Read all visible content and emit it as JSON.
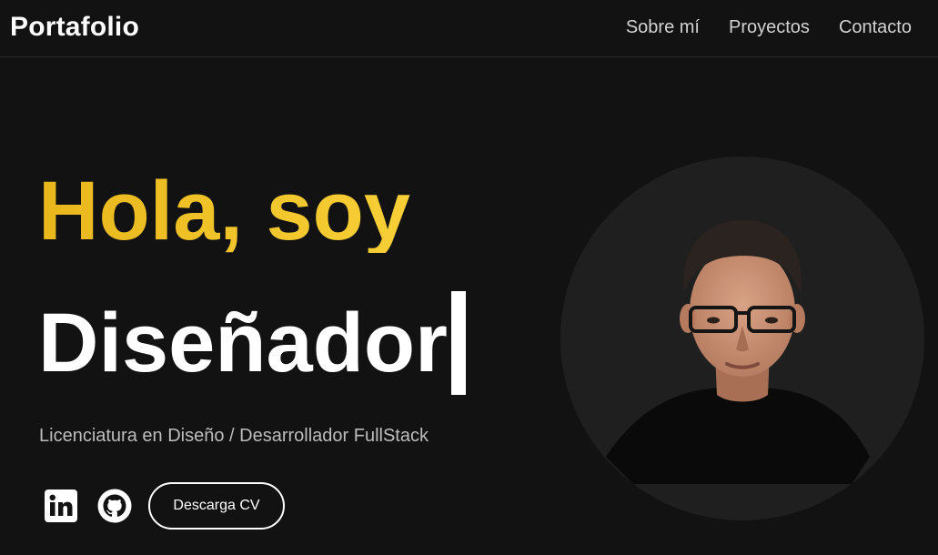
{
  "header": {
    "brand": "Portafolio",
    "nav": [
      {
        "label": "Sobre mí"
      },
      {
        "label": "Proyectos"
      },
      {
        "label": "Contacto"
      }
    ]
  },
  "hero": {
    "greeting": "Hola, soy",
    "role": "Diseñador",
    "subtitle": "Licenciatura en Diseño / Desarrollador FullStack",
    "cv_button": "Descarga CV",
    "social": [
      {
        "icon": "linkedin-icon"
      },
      {
        "icon": "github-icon"
      }
    ]
  },
  "colors": {
    "background": "#121212",
    "accent_start": "#e8b71c",
    "accent_end": "#f8cf37",
    "text": "#ffffff",
    "muted": "#bdbdbd"
  }
}
